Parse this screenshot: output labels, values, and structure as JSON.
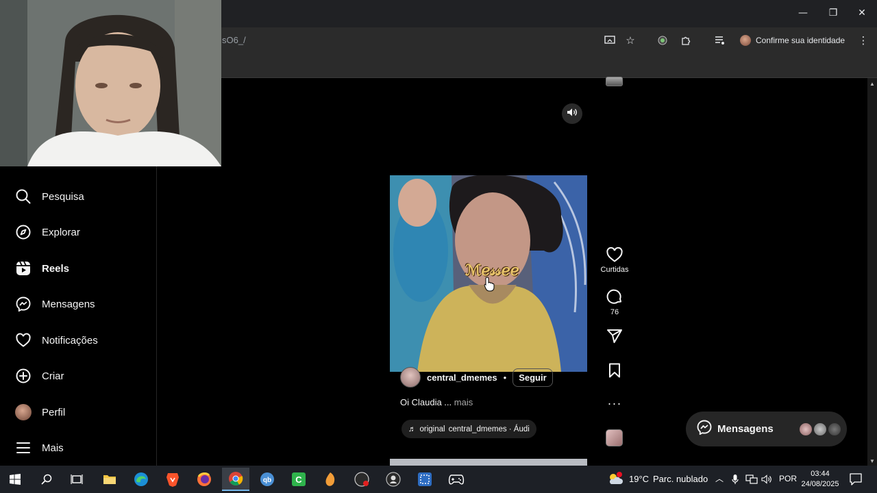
{
  "browser": {
    "url_fragment": "sO6_/",
    "identity_label": "Confirme sua identidade",
    "window_controls": [
      "minimize-icon",
      "restore-icon",
      "close-icon"
    ],
    "toolbar_icons": [
      "cast-icon",
      "bookmark-star-icon",
      "extension-shield-icon",
      "extensions-puzzle-icon",
      "media-queue-icon",
      "menu-dots-icon"
    ]
  },
  "sidebar": {
    "items": [
      {
        "label": "Pesquisa",
        "icon": "search-icon"
      },
      {
        "label": "Explorar",
        "icon": "compass-icon"
      },
      {
        "label": "Reels",
        "icon": "reels-icon",
        "active": true
      },
      {
        "label": "Mensagens",
        "icon": "messenger-icon"
      },
      {
        "label": "Notificações",
        "icon": "heart-icon"
      },
      {
        "label": "Criar",
        "icon": "plus-square-icon"
      },
      {
        "label": "Perfil",
        "icon": "profile-avatar"
      },
      {
        "label": "Mais",
        "icon": "hamburger-icon"
      }
    ]
  },
  "reel": {
    "overlay_text": "ℳℯ𝓈𝓈ℯℯ",
    "owner": "central_dmemes",
    "separator": "•",
    "follow_label": "Seguir",
    "caption": "Oi Claudia ...",
    "caption_more": "mais",
    "audio_original": "original",
    "audio_owner": "central_dmemes · Áudi",
    "actions": {
      "like_label": "Curtidas",
      "comment_count": "76"
    }
  },
  "messages_widget": {
    "label": "Mensagens"
  },
  "taskbar": {
    "apps": [
      "windows-start-icon",
      "search-icon",
      "task-view-icon",
      "file-explorer-icon",
      "edge-icon",
      "brave-icon",
      "firefox-icon",
      "chrome-icon",
      "qbittorrent-icon",
      "camtasia-icon",
      "fl-studio-icon",
      "obs-icon",
      "xsplit-icon",
      "snipping-icon",
      "game-controller-icon"
    ],
    "active_app": "chrome-icon",
    "weather_temp": "19°C",
    "weather_desc": "Parc. nublado",
    "language": "POR",
    "time": "03:44",
    "date": "24/08/2025"
  },
  "colors": {
    "page_bg": "#000000",
    "chrome_bg": "#202124",
    "taskbar_bg": "#1d2026",
    "active_accent": "#76b9ed"
  }
}
